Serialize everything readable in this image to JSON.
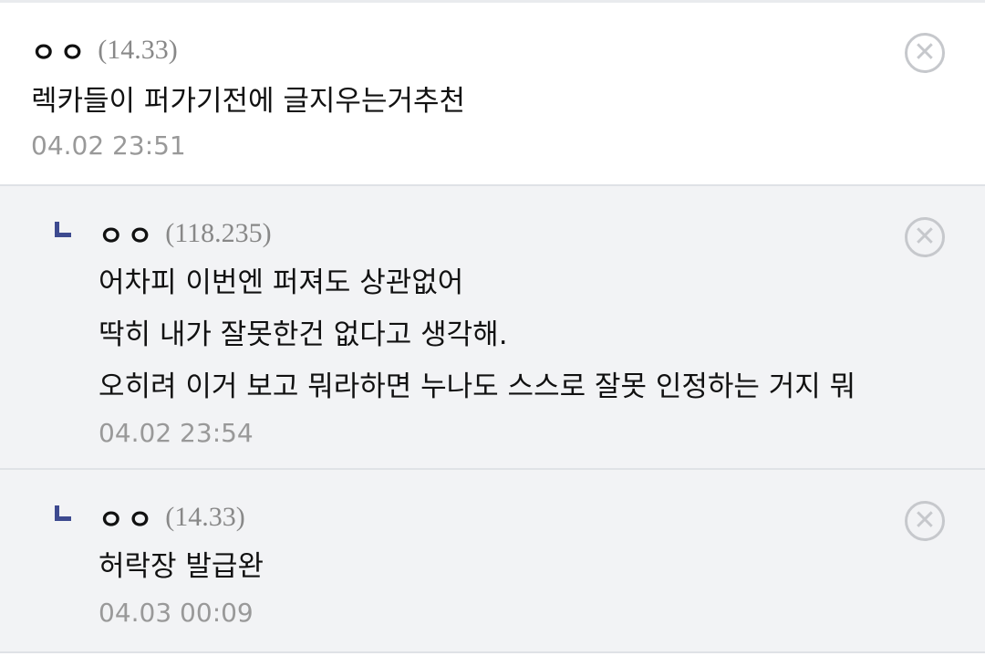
{
  "comments": [
    {
      "nick": "ㅇㅇ",
      "ip": "(14.33)",
      "lines": [
        "렉카들이 퍼가기전에 글지우는거추천"
      ],
      "date": "04.02 23:51",
      "delete_icon": "circle-x-icon"
    },
    {
      "nick": "ㅇㅇ",
      "ip": "(118.235)",
      "lines": [
        "어차피 이번엔 퍼져도 상관없어",
        "딱히 내가 잘못한건 없다고 생각해.",
        "오히려 이거 보고 뭐라하면 누나도 스스로 잘못 인정하는 거지 뭐"
      ],
      "date": "04.02 23:54",
      "reply_icon": "reply-arrow-icon",
      "delete_icon": "circle-x-icon"
    },
    {
      "nick": "ㅇㅇ",
      "ip": "(14.33)",
      "lines": [
        "허락장 발급완"
      ],
      "date": "04.03 00:09",
      "reply_icon": "reply-arrow-icon",
      "delete_icon": "circle-x-icon"
    }
  ],
  "colors": {
    "reply_background": "#f2f3f5",
    "reply_marker": "#3d4a8f",
    "divider": "#dfe2e6"
  }
}
